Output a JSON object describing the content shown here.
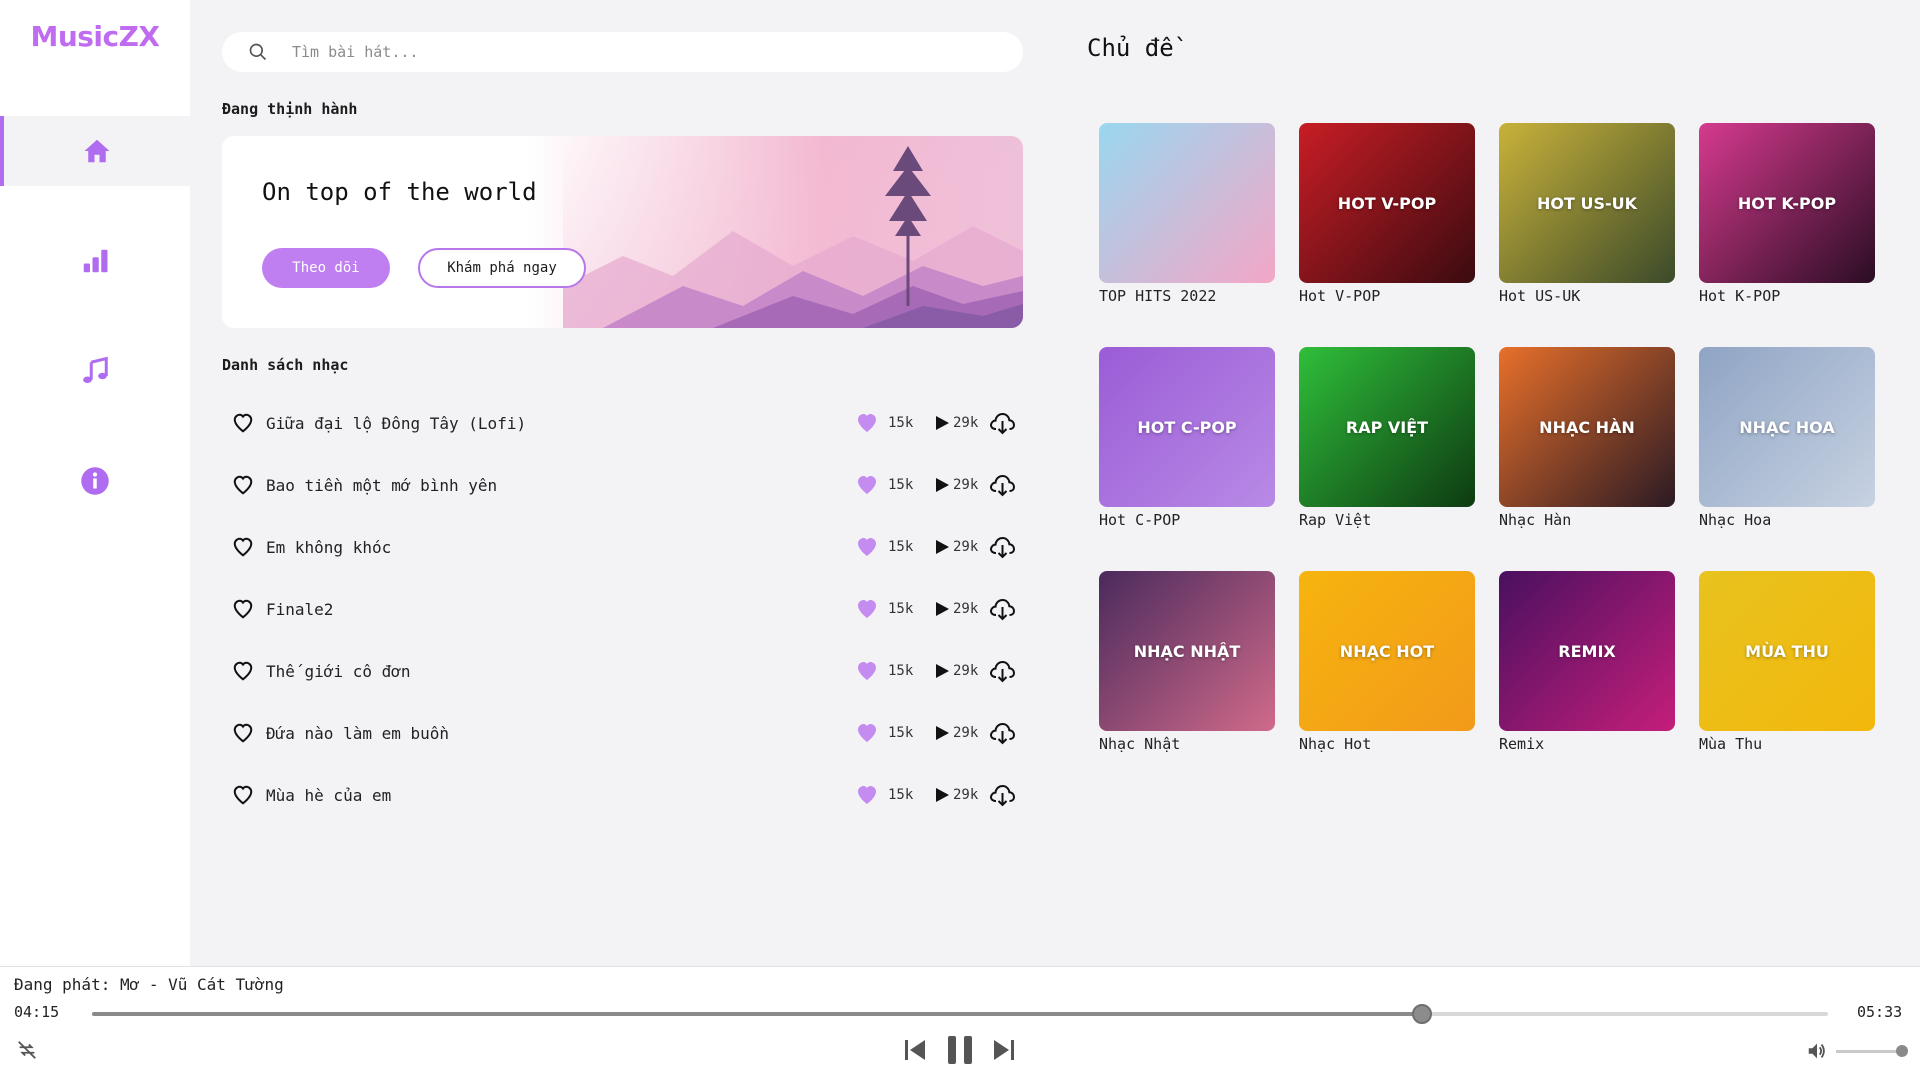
{
  "app": {
    "logo": "MusicZX"
  },
  "sidebar": {
    "items": [
      {
        "name": "home",
        "icon": "home-icon",
        "active": true
      },
      {
        "name": "charts",
        "icon": "bar-chart-icon",
        "active": false
      },
      {
        "name": "music",
        "icon": "music-note-icon",
        "active": false
      },
      {
        "name": "about",
        "icon": "info-icon",
        "active": false
      }
    ]
  },
  "search": {
    "placeholder": "Tìm bài hát..."
  },
  "trending": {
    "label": "Đang thịnh hành",
    "banner_title": "On top of the world",
    "follow_label": "Theo dõi",
    "explore_label": "Khám phá ngay"
  },
  "playlist": {
    "label": "Danh sách nhạc",
    "songs": [
      {
        "title": "Giữa đại lộ Đông Tây (Lofi)",
        "likes": "15k",
        "plays": "29k"
      },
      {
        "title": "Bao tiền một mớ bình yên",
        "likes": "15k",
        "plays": "29k"
      },
      {
        "title": "Em không khóc",
        "likes": "15k",
        "plays": "29k"
      },
      {
        "title": "Finale2",
        "likes": "15k",
        "plays": "29k"
      },
      {
        "title": "Thế giới cô đơn",
        "likes": "15k",
        "plays": "29k"
      },
      {
        "title": "Đứa nào làm em buồn",
        "likes": "15k",
        "plays": "29k"
      },
      {
        "title": "Mùa hè của em",
        "likes": "15k",
        "plays": "29k"
      }
    ]
  },
  "topics": {
    "title": "Chủ đề",
    "items": [
      {
        "overlay": "",
        "caption": "TOP HITS 2022",
        "color1": "#9ad7f0",
        "color2": "#f4a6c6"
      },
      {
        "overlay": "HOT V-POP",
        "caption": "Hot V-POP",
        "color1": "#c81d25",
        "color2": "#3a0b10"
      },
      {
        "overlay": "HOT US-UK",
        "caption": "Hot US-UK",
        "color1": "#c9b23a",
        "color2": "#3b4a2a"
      },
      {
        "overlay": "HOT K-POP",
        "caption": "Hot K-POP",
        "color1": "#d63a8e",
        "color2": "#2a0d24"
      },
      {
        "overlay": "HOT C-POP",
        "caption": "Hot C-POP",
        "color1": "#9b5cd6",
        "color2": "#b88ae6"
      },
      {
        "overlay": "RAP VIỆT",
        "caption": "Rap Việt",
        "color1": "#2fbf3a",
        "color2": "#0e3a12"
      },
      {
        "overlay": "NHẠC HÀN",
        "caption": "Nhạc Hàn",
        "color1": "#e8702a",
        "color2": "#2b1a24"
      },
      {
        "overlay": "NHẠC HOA",
        "caption": "Nhạc Hoa",
        "color1": "#8fa4c4",
        "color2": "#c7d2e2"
      },
      {
        "overlay": "NHẠC NHẬT",
        "caption": "Nhạc Nhật",
        "color1": "#4a2a5c",
        "color2": "#d06a8a"
      },
      {
        "overlay": "NHẠC HOT",
        "caption": "Nhạc Hot",
        "color1": "#f6b40e",
        "color2": "#f29a1a"
      },
      {
        "overlay": "REMIX",
        "caption": "Remix",
        "color1": "#4a1060",
        "color2": "#c41e7a"
      },
      {
        "overlay": "MÙA THU",
        "caption": "Mùa Thu",
        "color1": "#e8c21e",
        "color2": "#f2b80c"
      }
    ]
  },
  "player": {
    "now_playing": "Đang phát: Mơ - Vũ Cát Tường",
    "current_time": "04:15",
    "total_time": "05:33",
    "progress": 0.766,
    "volume": 0.97
  }
}
